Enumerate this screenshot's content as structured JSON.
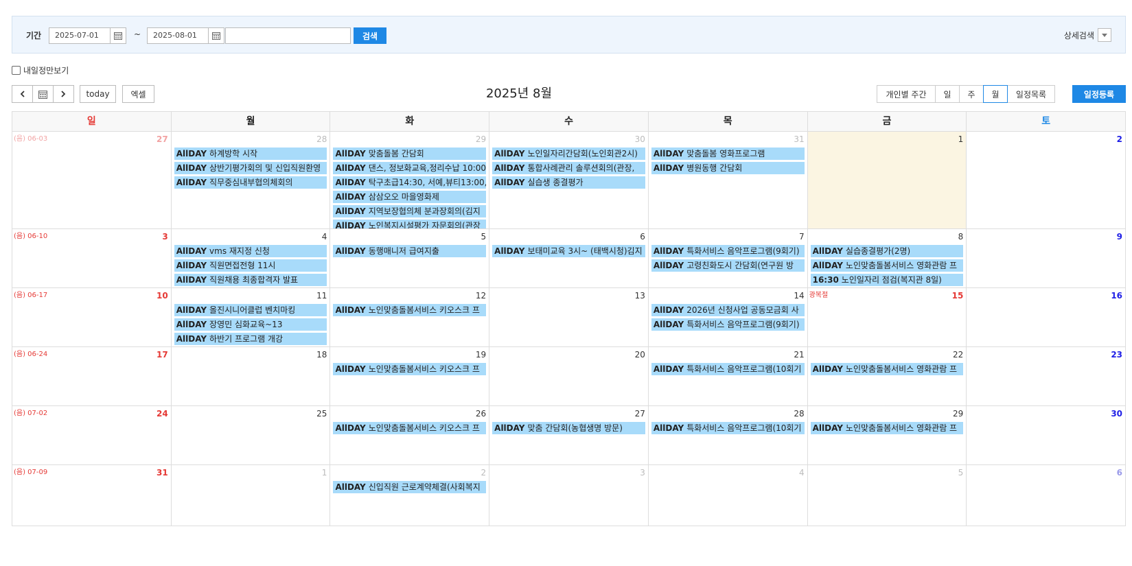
{
  "search": {
    "period_label": "기간",
    "start_date": "2025-07-01",
    "end_date": "2025-08-01",
    "tilde": "~",
    "keyword_value": "",
    "search_button": "검색",
    "detail_label": "상세검색"
  },
  "toolbar": {
    "tomorrow_label": "내일정만보기",
    "today_button": "today",
    "excel_button": "엑셀",
    "month_title": "2025년 8월",
    "views": [
      "개인별 주간",
      "일",
      "주",
      "월",
      "일정목록"
    ],
    "active_view": "월",
    "register_button": "일정등록"
  },
  "colors": {
    "accent": "#1e88e5",
    "event_bg": "#a8dbfa",
    "today_bg": "#fbf5e2",
    "sunday": "#e53935",
    "saturday": "#1e1ee6"
  },
  "calendar": {
    "weekdays": [
      "일",
      "월",
      "화",
      "수",
      "목",
      "금",
      "토"
    ],
    "weeks": [
      {
        "days": [
          {
            "num": "27",
            "other": true,
            "lunar": "(음) 06-03",
            "events": []
          },
          {
            "num": "28",
            "other": true,
            "events": [
              {
                "tag": "AllDAY",
                "text": "하계방학 시작"
              },
              {
                "tag": "AllDAY",
                "text": "상반기평가회의 및 신입직원환영"
              },
              {
                "tag": "AllDAY",
                "text": "직무중심내부협의체회의"
              }
            ]
          },
          {
            "num": "29",
            "other": true,
            "events": [
              {
                "tag": "AllDAY",
                "text": "맞춤돌봄 간담회"
              },
              {
                "tag": "AllDAY",
                "text": "댄스, 정보화교육,정리수납 10:00"
              },
              {
                "tag": "AllDAY",
                "text": "탁구초급14:30, 서예,뷰티13:00,"
              },
              {
                "tag": "AllDAY",
                "text": "삼삼오오 마을영화제"
              },
              {
                "tag": "AllDAY",
                "text": "지역보장협의체 분과장회의(김지"
              },
              {
                "tag": "AllDAY",
                "text": "노인복지시설평가 자문회의(관장"
              }
            ]
          },
          {
            "num": "30",
            "other": true,
            "events": [
              {
                "tag": "AllDAY",
                "text": "노인일자리간담회(노인회관2시)"
              },
              {
                "tag": "AllDAY",
                "text": "통합사례관리 솔루션회의(관장,"
              },
              {
                "tag": "AllDAY",
                "text": "실습생 종결평가"
              }
            ]
          },
          {
            "num": "31",
            "other": true,
            "events": [
              {
                "tag": "AllDAY",
                "text": "맞춤돌봄 영화프로그램"
              },
              {
                "tag": "AllDAY",
                "text": "병원동행 간담회"
              }
            ]
          },
          {
            "num": "1",
            "today": true,
            "events": []
          },
          {
            "num": "2",
            "events": []
          }
        ]
      },
      {
        "days": [
          {
            "num": "3",
            "lunar": "(음) 06-10",
            "events": []
          },
          {
            "num": "4",
            "events": [
              {
                "tag": "AllDAY",
                "text": "vms 재지정 신청"
              },
              {
                "tag": "AllDAY",
                "text": "직원면접전형 11시"
              },
              {
                "tag": "AllDAY",
                "text": "직원채용 최종합격자 발표"
              }
            ]
          },
          {
            "num": "5",
            "events": [
              {
                "tag": "AllDAY",
                "text": "동행매니저 급여지출"
              }
            ]
          },
          {
            "num": "6",
            "events": [
              {
                "tag": "AllDAY",
                "text": "보태미교육 3시~ (태백시청)김지"
              }
            ]
          },
          {
            "num": "7",
            "events": [
              {
                "tag": "AllDAY",
                "text": "특화서비스 음악프로그램(9회기)"
              },
              {
                "tag": "AllDAY",
                "text": "고령친화도시 간담회(연구원 방"
              }
            ]
          },
          {
            "num": "8",
            "events": [
              {
                "tag": "AllDAY",
                "text": "실습종결평가(2명)"
              },
              {
                "tag": "AllDAY",
                "text": "노인맞춤돌봄서비스 영화관람 프"
              },
              {
                "tag": "16:30",
                "text": "노인일자리 점검(복지관 8일)"
              }
            ]
          },
          {
            "num": "9",
            "events": []
          }
        ]
      },
      {
        "days": [
          {
            "num": "10",
            "lunar": "(음) 06-17",
            "events": []
          },
          {
            "num": "11",
            "events": [
              {
                "tag": "AllDAY",
                "text": "올진시니어클럽 벤치마킹"
              },
              {
                "tag": "AllDAY",
                "text": "장영민 심화교육~13"
              },
              {
                "tag": "AllDAY",
                "text": "하반기 프로그램 개강"
              }
            ]
          },
          {
            "num": "12",
            "events": [
              {
                "tag": "AllDAY",
                "text": "노인맞춤돌봄서비스 키오스크 프"
              }
            ]
          },
          {
            "num": "13",
            "events": []
          },
          {
            "num": "14",
            "events": [
              {
                "tag": "AllDAY",
                "text": "2026년 신청사업 공동모금회 사"
              },
              {
                "tag": "AllDAY",
                "text": "특화서비스 음악프로그램(9회기)"
              }
            ]
          },
          {
            "num": "15",
            "holiday": "광복절",
            "events": []
          },
          {
            "num": "16",
            "events": []
          }
        ]
      },
      {
        "days": [
          {
            "num": "17",
            "lunar": "(음) 06-24",
            "events": []
          },
          {
            "num": "18",
            "events": []
          },
          {
            "num": "19",
            "events": [
              {
                "tag": "AllDAY",
                "text": "노인맞춤돌봄서비스 키오스크 프"
              }
            ]
          },
          {
            "num": "20",
            "events": []
          },
          {
            "num": "21",
            "events": [
              {
                "tag": "AllDAY",
                "text": "특화서비스 음악프로그램(10회기"
              }
            ]
          },
          {
            "num": "22",
            "events": [
              {
                "tag": "AllDAY",
                "text": "노인맞춤돌봄서비스 영화관람 프"
              }
            ]
          },
          {
            "num": "23",
            "events": []
          }
        ]
      },
      {
        "days": [
          {
            "num": "24",
            "lunar": "(음) 07-02",
            "events": []
          },
          {
            "num": "25",
            "events": []
          },
          {
            "num": "26",
            "events": [
              {
                "tag": "AllDAY",
                "text": "노인맞춤돌봄서비스 키오스크 프"
              }
            ]
          },
          {
            "num": "27",
            "events": [
              {
                "tag": "AllDAY",
                "text": "맞춤 간담회(농협생명 방문)"
              }
            ]
          },
          {
            "num": "28",
            "events": [
              {
                "tag": "AllDAY",
                "text": "특화서비스 음악프로그램(10회기"
              }
            ]
          },
          {
            "num": "29",
            "events": [
              {
                "tag": "AllDAY",
                "text": "노인맞춤돌봄서비스 영화관람 프"
              }
            ]
          },
          {
            "num": "30",
            "events": []
          }
        ]
      },
      {
        "days": [
          {
            "num": "31",
            "lunar": "(음) 07-09",
            "events": []
          },
          {
            "num": "1",
            "other": true,
            "events": []
          },
          {
            "num": "2",
            "other": true,
            "events": [
              {
                "tag": "AllDAY",
                "text": "신입직원 근로계약체결(사회복지"
              }
            ]
          },
          {
            "num": "3",
            "other": true,
            "events": []
          },
          {
            "num": "4",
            "other": true,
            "events": []
          },
          {
            "num": "5",
            "other": true,
            "events": []
          },
          {
            "num": "6",
            "other": true,
            "events": []
          }
        ]
      }
    ]
  }
}
